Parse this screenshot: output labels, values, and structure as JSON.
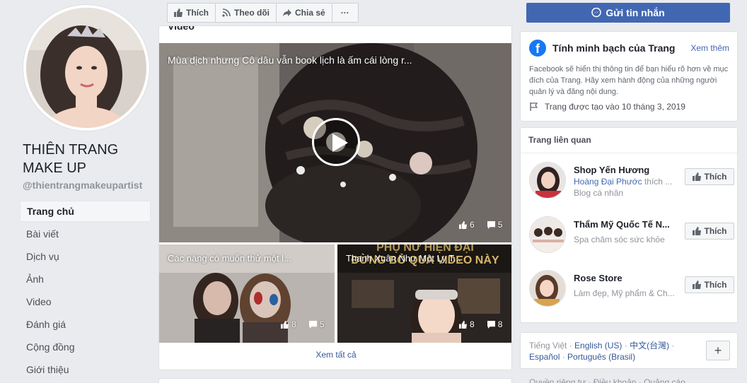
{
  "profile": {
    "name": "THIÊN TRANG MAKE UP",
    "handle": "@thientrangmakeupartist"
  },
  "nav": [
    {
      "label": "Trang chủ",
      "active": true
    },
    {
      "label": "Bài viết"
    },
    {
      "label": "Dịch vụ"
    },
    {
      "label": "Ảnh"
    },
    {
      "label": "Video"
    },
    {
      "label": "Đánh giá"
    },
    {
      "label": "Cộng đồng"
    },
    {
      "label": "Giới thiệu"
    }
  ],
  "actions": {
    "like": "Thích",
    "follow": "Theo dõi",
    "share": "Chia sẻ",
    "more": "···",
    "send_message": "Gửi tin nhắn"
  },
  "videos": {
    "heading": "Video",
    "main": {
      "title": "Mùa dịch nhưng Cô dâu vẫn book lịch là ấm cái lòng r...",
      "likes": "6",
      "comments": "5"
    },
    "thumb1": {
      "title": "Các nàng có muốn thử một l...",
      "likes": "8",
      "comments": "5"
    },
    "thumb2": {
      "title": "Thanh Xuân Như Một Ly T...",
      "likes": "8",
      "comments": "8",
      "overlay_line1": "PHỤ NỮ HIỆN ĐẠI",
      "overlay_line2": "ĐỪNG BỎ QUA VIDEO NÀY"
    },
    "see_all": "Xem tất cả"
  },
  "transparency": {
    "title": "Tính minh bạch của Trang",
    "see_more": "Xem thêm",
    "description": "Facebook sẽ hiển thị thông tin để bạn hiểu rõ hơn về mục đích của Trang. Hãy xem hành động của những người quản lý và đăng nội dung.",
    "created": "Trang được tạo vào 10 tháng 3, 2019"
  },
  "related": {
    "heading": "Trang liên quan",
    "like_label": "Thích",
    "items": [
      {
        "name": "Shop Yến Hương",
        "liker": "Hoàng Đại Phước",
        "liker_suffix": " thích ...",
        "category": "Blog cá nhân"
      },
      {
        "name": "Thẩm Mỹ Quốc Tế N...",
        "category": "Spa chăm sóc sức khỏe"
      },
      {
        "name": "Rose Store",
        "category": "Làm đẹp, Mỹ phẩm & Ch..."
      }
    ]
  },
  "languages": {
    "current": "Tiếng Việt",
    "sep": " · ",
    "options": [
      "English (US)",
      "中文(台灣)",
      "Español",
      "Português (Brasil)"
    ],
    "add": "+"
  },
  "footer": {
    "text": "Quyền riêng tư · Điều khoản · Quảng cáo"
  },
  "colors": {
    "brand_blue": "#4267b2",
    "background": "#e9ebee"
  }
}
